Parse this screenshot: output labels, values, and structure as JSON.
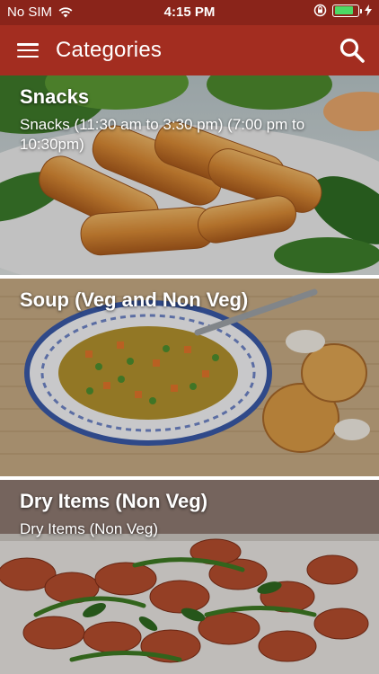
{
  "status_bar": {
    "carrier": "No SIM",
    "time": "4:15 PM",
    "battery_level": 0.8
  },
  "app_bar": {
    "title": "Categories",
    "menu_icon": "hamburger-menu-icon",
    "search_icon": "search-icon"
  },
  "categories": [
    {
      "title": "Snacks",
      "subtitle": "Snacks (11:30 am to 3:30 pm) (7:00 pm to 10:30pm)"
    },
    {
      "title": "Soup (Veg and Non Veg)",
      "subtitle": ""
    },
    {
      "title": "Dry Items (Non Veg)",
      "subtitle": "Dry Items (Non Veg)"
    }
  ],
  "colors": {
    "status_bar": "#8a241a",
    "app_bar": "#a32d20",
    "battery_fill": "#4cd964"
  }
}
